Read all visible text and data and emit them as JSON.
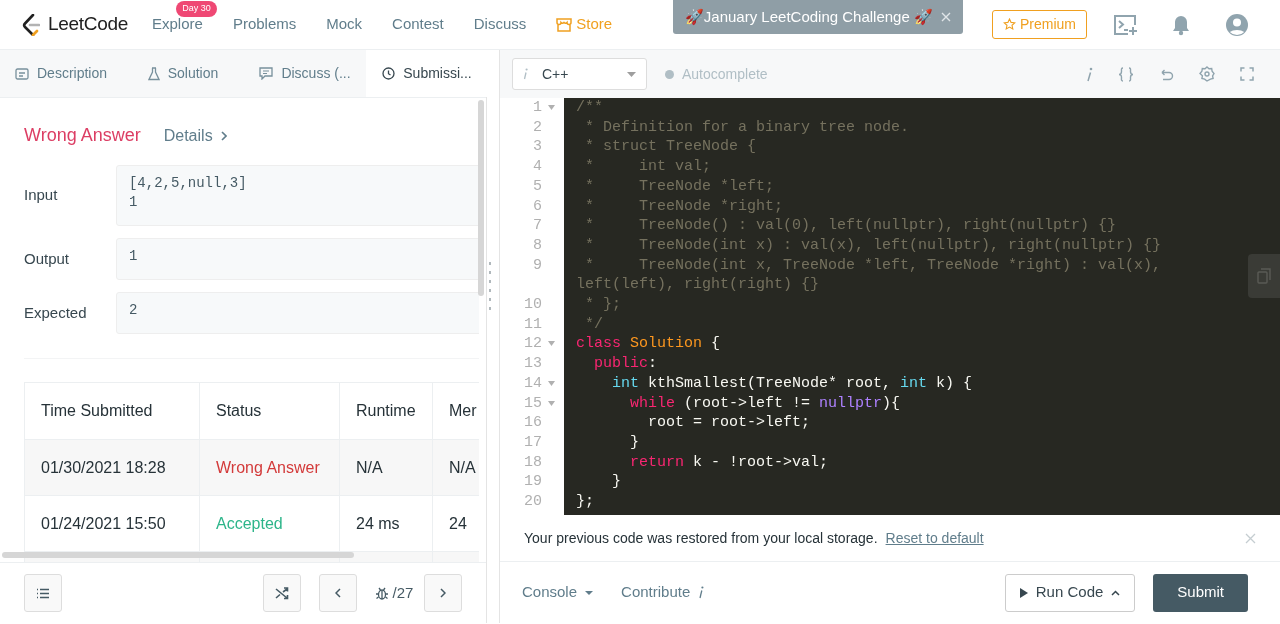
{
  "navbar": {
    "logo": "LeetCode",
    "links": [
      {
        "label": "Explore",
        "badge": "Day 30",
        "kind": "plain"
      },
      {
        "label": "Problems",
        "kind": "plain"
      },
      {
        "label": "Mock",
        "kind": "plain"
      },
      {
        "label": "Contest",
        "kind": "plain"
      },
      {
        "label": "Discuss",
        "kind": "plain"
      },
      {
        "label": "Store",
        "kind": "store"
      }
    ],
    "banner": {
      "text": "🚀January LeetCoding Challenge 🚀"
    },
    "premium": "Premium"
  },
  "left_tabs": [
    {
      "label": "Description",
      "selected": false
    },
    {
      "label": "Solution",
      "selected": false
    },
    {
      "label": "Discuss (...",
      "selected": false
    },
    {
      "label": "Submissi...",
      "selected": true
    }
  ],
  "result": {
    "status": "Wrong Answer",
    "details": "Details",
    "fields": [
      {
        "label": "Input",
        "lines": [
          "[4,2,5,null,3]",
          "1"
        ]
      },
      {
        "label": "Output",
        "lines": [
          "1"
        ]
      },
      {
        "label": "Expected",
        "lines": [
          "2"
        ]
      }
    ]
  },
  "submissions": {
    "columns": [
      "Time Submitted",
      "Status",
      "Runtime",
      "Mer"
    ],
    "rows": [
      {
        "cells": [
          "01/30/2021 18:28",
          "Wrong Answer",
          "N/A",
          "N/A"
        ],
        "kind": "wrong"
      },
      {
        "cells": [
          "01/24/2021 15:50",
          "Accepted",
          "24 ms",
          "24"
        ],
        "kind": "accepted"
      }
    ]
  },
  "left_footer": {
    "counter": "/27"
  },
  "editor": {
    "language": "C++",
    "autocomplete": {
      "label": "Autocomplete",
      "on": false
    },
    "lines": [
      {
        "n": "1",
        "fold": true,
        "tokens": [
          {
            "t": "/**",
            "kind": "comment"
          }
        ]
      },
      {
        "n": "2",
        "fold": false,
        "tokens": [
          {
            "t": " * Definition for a binary tree node.",
            "kind": "comment"
          }
        ]
      },
      {
        "n": "3",
        "fold": false,
        "tokens": [
          {
            "t": " * struct TreeNode {",
            "kind": "comment"
          }
        ]
      },
      {
        "n": "4",
        "fold": false,
        "tokens": [
          {
            "t": " *     int val;",
            "kind": "comment"
          }
        ]
      },
      {
        "n": "5",
        "fold": false,
        "tokens": [
          {
            "t": " *     TreeNode *left;",
            "kind": "comment"
          }
        ]
      },
      {
        "n": "6",
        "fold": false,
        "tokens": [
          {
            "t": " *     TreeNode *right;",
            "kind": "comment"
          }
        ]
      },
      {
        "n": "7",
        "fold": false,
        "tokens": [
          {
            "t": " *     TreeNode() : val(0), left(nullptr), right(nullptr) {}",
            "kind": "comment"
          }
        ]
      },
      {
        "n": "8",
        "fold": false,
        "tokens": [
          {
            "t": " *     TreeNode(int x) : val(x), left(nullptr), right(nullptr) {}",
            "kind": "comment"
          }
        ]
      },
      {
        "n": "9",
        "fold": false,
        "tokens": [
          {
            "t": " *     TreeNode(int x, TreeNode *left, TreeNode *right) : val(x), left(left), right(right) {}",
            "kind": "comment"
          }
        ]
      },
      {
        "n": "10",
        "fold": false,
        "tokens": [
          {
            "t": " * };",
            "kind": "comment"
          }
        ]
      },
      {
        "n": "11",
        "fold": false,
        "tokens": [
          {
            "t": " */",
            "kind": "comment"
          }
        ]
      },
      {
        "n": "12",
        "fold": true,
        "tokens": [
          {
            "t": "class ",
            "kind": "keyword"
          },
          {
            "t": "Solution",
            "kind": "classname"
          },
          {
            "t": " {",
            "kind": "plain"
          }
        ]
      },
      {
        "n": "13",
        "fold": false,
        "tokens": [
          {
            "t": "  public",
            "kind": "keyword"
          },
          {
            "t": ":",
            "kind": "plain"
          }
        ]
      },
      {
        "n": "14",
        "fold": true,
        "tokens": [
          {
            "t": "    int",
            "kind": "type"
          },
          {
            "t": " kthSmallest(TreeNode* root, ",
            "kind": "plain"
          },
          {
            "t": "int",
            "kind": "type"
          },
          {
            "t": " k) {",
            "kind": "plain"
          }
        ]
      },
      {
        "n": "15",
        "fold": true,
        "tokens": [
          {
            "t": "      while",
            "kind": "keyword"
          },
          {
            "t": " (root->left != ",
            "kind": "plain"
          },
          {
            "t": "nullptr",
            "kind": "constant"
          },
          {
            "t": "){",
            "kind": "plain"
          }
        ]
      },
      {
        "n": "16",
        "fold": false,
        "tokens": [
          {
            "t": "        root = root->left;",
            "kind": "plain"
          }
        ]
      },
      {
        "n": "17",
        "fold": false,
        "tokens": [
          {
            "t": "      }",
            "kind": "plain"
          }
        ]
      },
      {
        "n": "18",
        "fold": false,
        "tokens": [
          {
            "t": "      return",
            "kind": "keyword"
          },
          {
            "t": " k - !root->val;",
            "kind": "plain"
          }
        ]
      },
      {
        "n": "19",
        "fold": false,
        "tokens": [
          {
            "t": "    }",
            "kind": "plain"
          }
        ]
      },
      {
        "n": "20",
        "fold": false,
        "tokens": [
          {
            "t": "};",
            "kind": "plain"
          }
        ]
      }
    ]
  },
  "notice": {
    "text": "Your previous code was restored from your local storage.",
    "link": "Reset to default"
  },
  "right_footer": {
    "console": "Console",
    "contribute": "Contribute",
    "run": "Run Code",
    "submit": "Submit"
  }
}
